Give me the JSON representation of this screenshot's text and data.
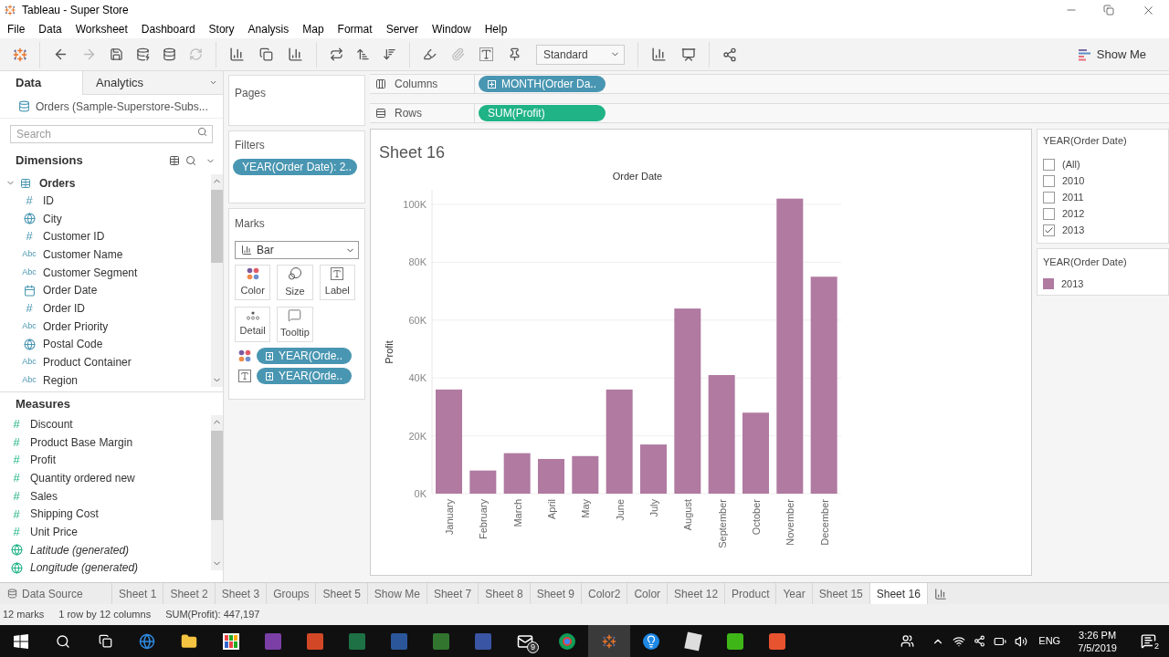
{
  "window": {
    "title": "Tableau - Super Store"
  },
  "menu": [
    "File",
    "Data",
    "Worksheet",
    "Dashboard",
    "Story",
    "Analysis",
    "Map",
    "Format",
    "Server",
    "Window",
    "Help"
  ],
  "toolbar": {
    "fit": "Standard",
    "show_me": "Show Me"
  },
  "data_pane": {
    "tabs": [
      {
        "label": "Data",
        "selected": true
      },
      {
        "label": "Analytics",
        "selected": false
      }
    ],
    "datasource": "Orders (Sample-Superstore-Subs...",
    "search": {
      "placeholder": "Search"
    },
    "dimensions": {
      "title": "Dimensions",
      "table": {
        "name": "Orders",
        "expanded": true,
        "children": [
          {
            "name": "ID",
            "kind": "number",
            "badge": "#"
          },
          {
            "name": "City",
            "kind": "geo"
          },
          {
            "name": "Customer ID",
            "kind": "number",
            "badge": "#"
          },
          {
            "name": "Customer Name",
            "kind": "text",
            "badge": "Abc"
          },
          {
            "name": "Customer Segment",
            "kind": "text",
            "badge": "Abc"
          },
          {
            "name": "Order Date",
            "kind": "date"
          },
          {
            "name": "Order ID",
            "kind": "number",
            "badge": "#"
          },
          {
            "name": "Order Priority",
            "kind": "text",
            "badge": "Abc"
          },
          {
            "name": "Postal Code",
            "kind": "geo"
          },
          {
            "name": "Product Container",
            "kind": "text",
            "badge": "Abc"
          },
          {
            "name": "Region",
            "kind": "text",
            "badge": "Abc"
          }
        ]
      }
    },
    "measures": {
      "title": "Measures",
      "items": [
        {
          "name": "Discount",
          "kind": "number",
          "badge": "#",
          "generated": false
        },
        {
          "name": "Product Base Margin",
          "kind": "number",
          "badge": "#",
          "generated": false
        },
        {
          "name": "Profit",
          "kind": "number",
          "badge": "#",
          "generated": false
        },
        {
          "name": "Quantity ordered new",
          "kind": "number",
          "badge": "#",
          "generated": false
        },
        {
          "name": "Sales",
          "kind": "number",
          "badge": "#",
          "generated": false
        },
        {
          "name": "Shipping Cost",
          "kind": "number",
          "badge": "#",
          "generated": false
        },
        {
          "name": "Unit Price",
          "kind": "number",
          "badge": "#",
          "generated": false
        },
        {
          "name": "Latitude (generated)",
          "kind": "geo",
          "generated": true
        },
        {
          "name": "Longitude (generated)",
          "kind": "geo",
          "generated": true
        }
      ]
    }
  },
  "pages": {
    "title": "Pages"
  },
  "filters": {
    "title": "Filters",
    "pills": [
      "YEAR(Order Date): 2.."
    ]
  },
  "marks": {
    "title": "Marks",
    "type": "Bar",
    "buttons": [
      {
        "label": "Color",
        "kind": "color"
      },
      {
        "label": "Size",
        "kind": "size"
      },
      {
        "label": "Label",
        "kind": "label"
      },
      {
        "label": "Detail",
        "kind": "detail"
      },
      {
        "label": "Tooltip",
        "kind": "tooltip"
      }
    ],
    "encodings": [
      {
        "kind": "color",
        "field": "YEAR(Orde.."
      },
      {
        "kind": "label",
        "field": "YEAR(Orde.."
      }
    ]
  },
  "shelves": [
    {
      "label": "Columns",
      "kind": "columns",
      "pill": {
        "text": "MONTH(Order Da..",
        "kind": "discrete"
      }
    },
    {
      "label": "Rows",
      "kind": "rows",
      "pill": {
        "text": "SUM(Profit)",
        "kind": "continuous"
      }
    }
  ],
  "sheet": {
    "title": "Sheet 16",
    "chart_data": {
      "type": "bar",
      "title": "Order Date",
      "ylabel": "Profit",
      "categories": [
        "January",
        "February",
        "March",
        "April",
        "May",
        "June",
        "July",
        "August",
        "September",
        "October",
        "November",
        "December"
      ],
      "series": [
        {
          "name": "2013",
          "color": "#b07aa1",
          "values": [
            36000,
            8000,
            14000,
            12000,
            13000,
            36000,
            17000,
            64000,
            41000,
            28000,
            102000,
            75000
          ]
        }
      ],
      "ylim": [
        0,
        105000
      ],
      "grid": true,
      "yticks": [
        {
          "value": 0,
          "label": "0K"
        },
        {
          "value": 20000,
          "label": "20K"
        },
        {
          "value": 40000,
          "label": "40K"
        },
        {
          "value": 60000,
          "label": "60K"
        },
        {
          "value": 80000,
          "label": "80K"
        },
        {
          "value": 100000,
          "label": "100K"
        }
      ]
    }
  },
  "filter_card": {
    "title": "YEAR(Order Date)",
    "options": [
      {
        "label": "(All)",
        "checked": false
      },
      {
        "label": "2010",
        "checked": false
      },
      {
        "label": "2011",
        "checked": false
      },
      {
        "label": "2012",
        "checked": false
      },
      {
        "label": "2013",
        "checked": true
      }
    ]
  },
  "legend": {
    "title": "YEAR(Order Date)"
  },
  "sheet_tabs": [
    {
      "label": "Data Source",
      "kind": "datasource",
      "selected": false
    },
    {
      "label": "Sheet 1",
      "kind": "sheet",
      "selected": false
    },
    {
      "label": "Sheet 2",
      "kind": "sheet",
      "selected": false
    },
    {
      "label": "Sheet 3",
      "kind": "sheet",
      "selected": false
    },
    {
      "label": "Groups",
      "kind": "sheet",
      "selected": false
    },
    {
      "label": "Sheet 5",
      "kind": "sheet",
      "selected": false
    },
    {
      "label": "Show Me",
      "kind": "sheet",
      "selected": false
    },
    {
      "label": "Sheet 7",
      "kind": "sheet",
      "selected": false
    },
    {
      "label": "Sheet 8",
      "kind": "sheet",
      "selected": false
    },
    {
      "label": "Sheet 9",
      "kind": "sheet",
      "selected": false
    },
    {
      "label": "Color2",
      "kind": "sheet",
      "selected": false
    },
    {
      "label": "Color",
      "kind": "sheet",
      "selected": false
    },
    {
      "label": "Sheet 12",
      "kind": "sheet",
      "selected": false
    },
    {
      "label": "Product",
      "kind": "sheet",
      "selected": false
    },
    {
      "label": "Year",
      "kind": "sheet",
      "selected": false
    },
    {
      "label": "Sheet 15",
      "kind": "sheet",
      "selected": false
    },
    {
      "label": "Sheet 16",
      "kind": "sheet",
      "selected": true
    }
  ],
  "status_bar": [
    "12 marks",
    "1 row by 12 columns",
    "SUM(Profit): 447,197"
  ],
  "taskbar": {
    "mail_badge": "9",
    "language": "ENG",
    "time": "3:26 PM",
    "date": "7/5/2019",
    "notifications": "2"
  }
}
